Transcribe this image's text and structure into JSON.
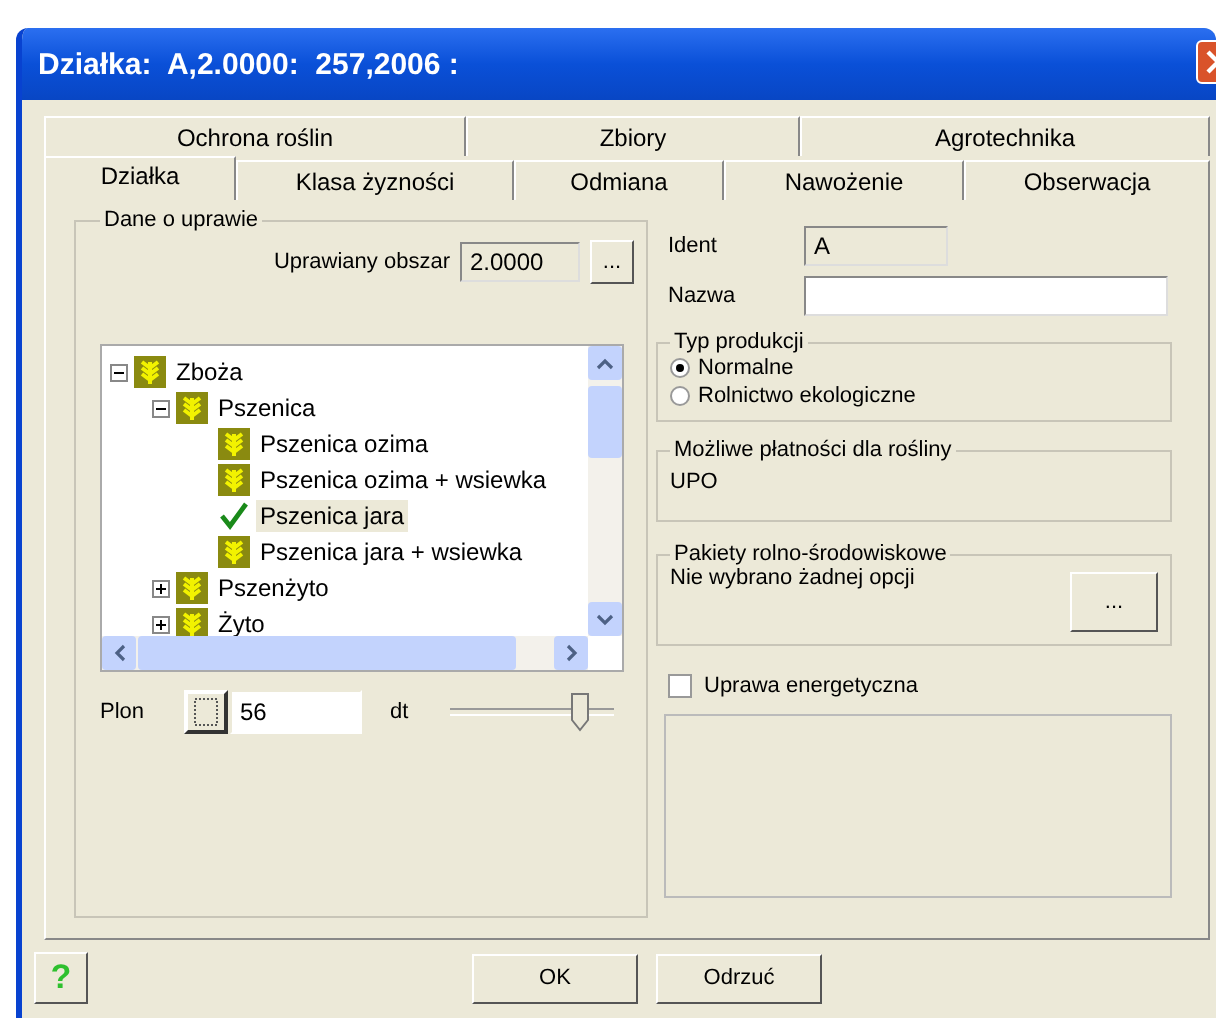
{
  "window": {
    "title": "Działka:  A,2.0000:  257,2006 :"
  },
  "tab_rows": [
    {
      "tabs": [
        {
          "label": "Ochrona roślin",
          "selected": false
        },
        {
          "label": "Zbiory",
          "selected": false
        },
        {
          "label": "Agrotechnika",
          "selected": false
        }
      ]
    },
    {
      "tabs": [
        {
          "label": "Działka",
          "selected": true
        },
        {
          "label": "Klasa żyzności",
          "selected": false
        },
        {
          "label": "Odmiana",
          "selected": false
        },
        {
          "label": "Nawożenie",
          "selected": false
        },
        {
          "label": "Obserwacja",
          "selected": false
        }
      ]
    }
  ],
  "crop_group": {
    "title": "Dane o uprawie",
    "area_label": "Uprawiany obszar",
    "area_value": "2.0000",
    "area_button": "...",
    "tree": [
      {
        "label": "Zboża",
        "expanded": true,
        "children": [
          {
            "label": "Pszenica",
            "expanded": true,
            "children": [
              {
                "label": "Pszenica ozima",
                "selected": false,
                "checked": false
              },
              {
                "label": "Pszenica ozima + wsiewka",
                "selected": false,
                "checked": false
              },
              {
                "label": "Pszenica jara",
                "selected": true,
                "checked": true
              },
              {
                "label": "Pszenica jara + wsiewka",
                "selected": false,
                "checked": false
              }
            ]
          },
          {
            "label": "Pszenżyto",
            "expanded": false
          },
          {
            "label": "Żyto",
            "expanded": false
          }
        ]
      }
    ],
    "yield": {
      "label": "Plon",
      "value": "56",
      "unit": "dt",
      "level": 0.85
    }
  },
  "ident": {
    "label": "Ident",
    "value": "A"
  },
  "name": {
    "label": "Nazwa"
  },
  "production_type": {
    "title": "Typ produkcji",
    "options": [
      {
        "label": "Normalne",
        "selected": true
      },
      {
        "label": "Rolnictwo ekologiczne",
        "selected": false
      }
    ]
  },
  "payments": {
    "title": "Możliwe płatności dla rośliny",
    "text": "UPO"
  },
  "packages": {
    "title": "Pakiety rolno-środowiskowe",
    "text": "Nie wybrano żadnej opcji",
    "button": "..."
  },
  "energy_crop": {
    "label": "Uprawa energetyczna",
    "checked": false
  },
  "help_button": "?",
  "buttons": [
    "OK",
    "Odrzuć"
  ]
}
